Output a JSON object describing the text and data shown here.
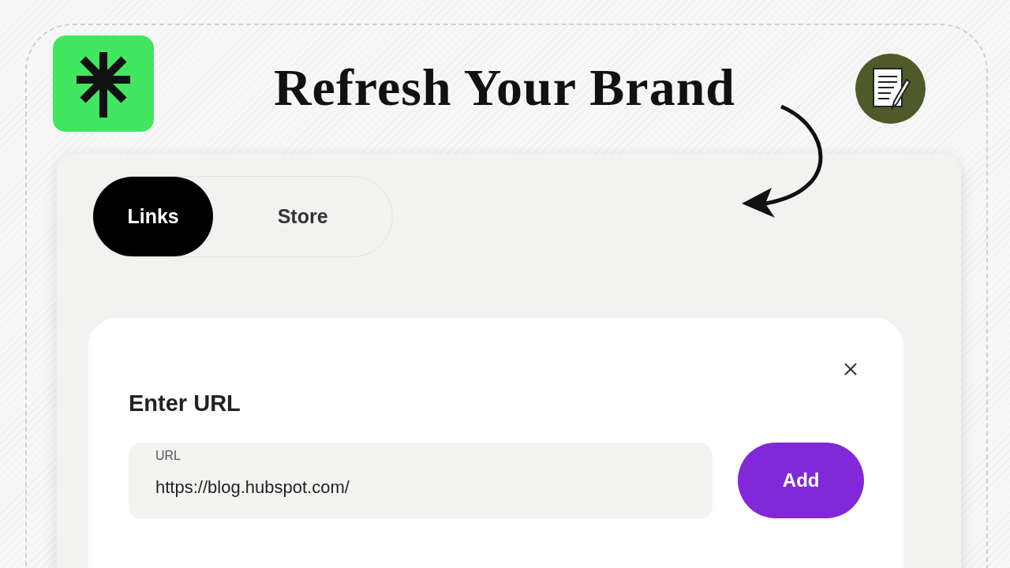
{
  "title": "Refresh Your Brand",
  "tabs": [
    {
      "label": "Links",
      "selected": true
    },
    {
      "label": "Store",
      "selected": false
    }
  ],
  "dialog": {
    "heading": "Enter URL",
    "url_field": {
      "label": "URL",
      "value": "https://blog.hubspot.com/"
    },
    "add_button": "Add"
  }
}
